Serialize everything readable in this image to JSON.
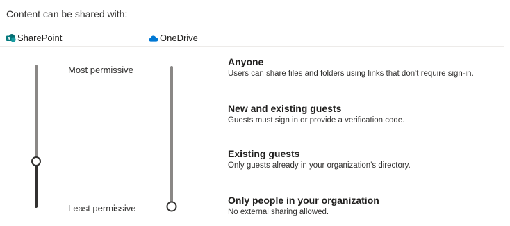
{
  "heading": "Content can be shared with:",
  "columns": {
    "sharepoint": {
      "label": "SharePoint",
      "icon": "sharepoint-icon",
      "selected_level": 3
    },
    "onedrive": {
      "label": "OneDrive",
      "icon": "onedrive-icon",
      "selected_level": 4
    }
  },
  "scale": {
    "most": "Most permissive",
    "least": "Least permissive"
  },
  "options": [
    {
      "title": "Anyone",
      "description": "Users can share files and folders using links that don't require sign-in."
    },
    {
      "title": "New and existing guests",
      "description": "Guests must sign in or provide a verification code."
    },
    {
      "title": "Existing guests",
      "description": "Only guests already in your organization's directory."
    },
    {
      "title": "Only people in your organization",
      "description": "No external sharing allowed."
    }
  ],
  "colors": {
    "sharepoint_brand": "#038387",
    "onedrive_brand": "#0078d4",
    "track_inactive": "#8a8886",
    "track_active": "#323130"
  }
}
